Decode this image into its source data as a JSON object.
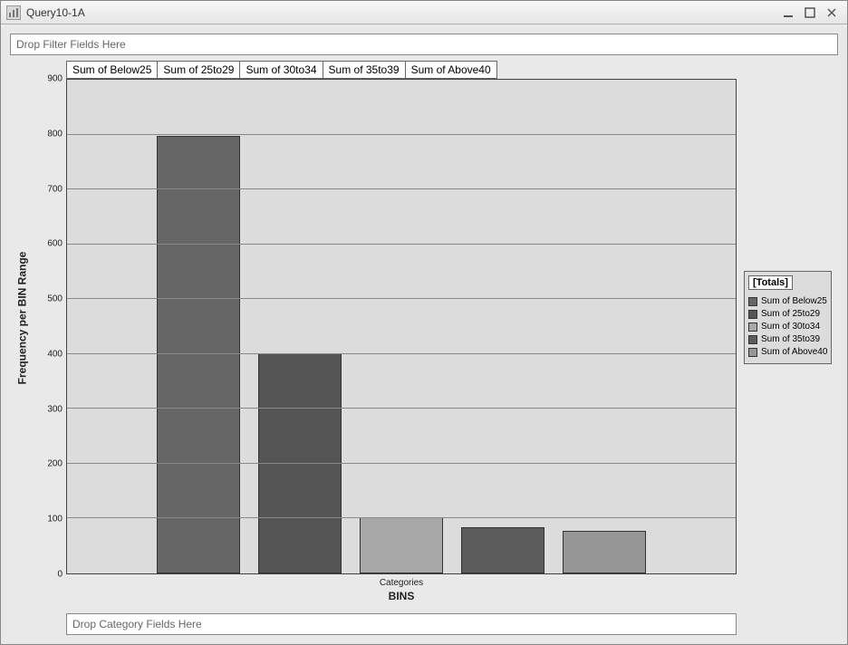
{
  "window": {
    "title": "Query10-1A"
  },
  "dropzones": {
    "filter": "Drop Filter Fields Here",
    "category": "Drop Category Fields Here"
  },
  "axes": {
    "ylabel": "Frequency per BIN Range",
    "sublabel": "Categories",
    "xlabel": "BINS"
  },
  "legend_title": "[Totals]",
  "chart_data": {
    "type": "bar",
    "categories": [
      "Sum of Below25",
      "Sum of 25to29",
      "Sum of 30to34",
      "Sum of 35to39",
      "Sum of Above40"
    ],
    "values": [
      798,
      402,
      102,
      85,
      78
    ],
    "colors": [
      "#666666",
      "#555555",
      "#a8a8a8",
      "#5c5c5c",
      "#969696"
    ],
    "title": "",
    "xlabel": "BINS",
    "ylabel": "Frequency per BIN Range",
    "ylim": [
      0,
      900
    ],
    "yticks": [
      0,
      100,
      200,
      300,
      400,
      500,
      600,
      700,
      800,
      900
    ],
    "grid": true,
    "legend_position": "right"
  }
}
